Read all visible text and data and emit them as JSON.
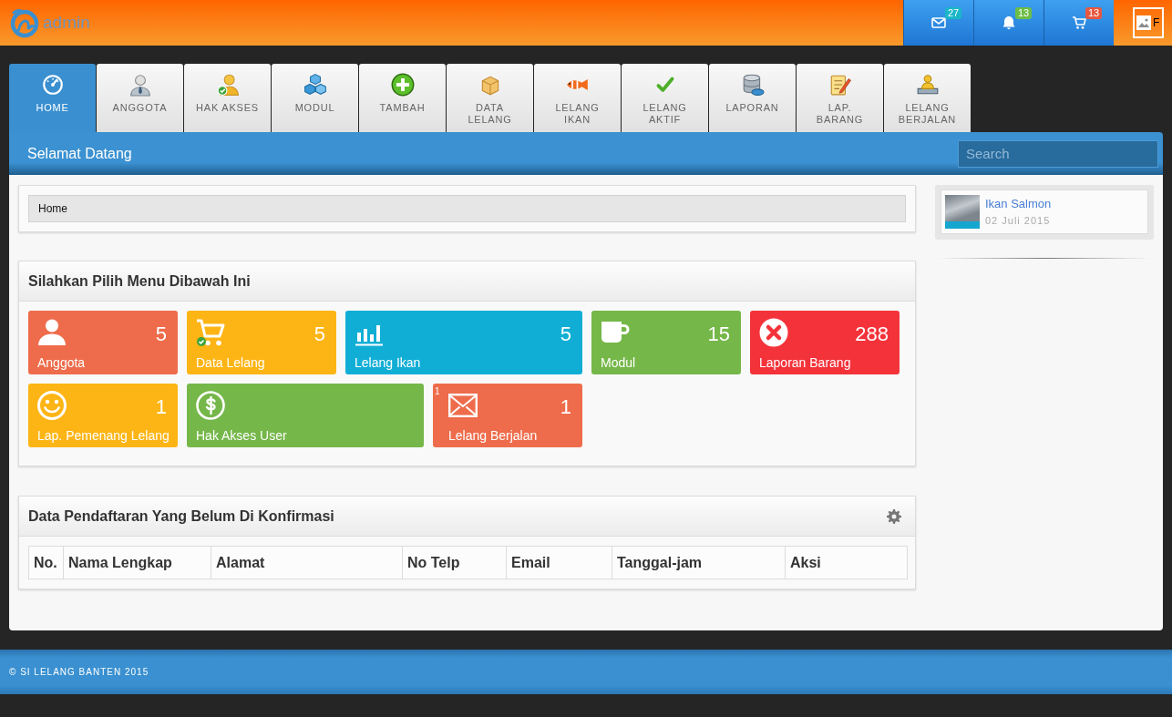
{
  "header": {
    "logo_text": "admin",
    "notifications": [
      {
        "count": "27",
        "color": "#1ab6c8"
      },
      {
        "count": "13",
        "color": "#6cbd45"
      },
      {
        "count": "13",
        "color": "#e8573f"
      }
    ],
    "user": {
      "label": "F"
    }
  },
  "tabs": [
    {
      "label": "HOME",
      "selected": true
    },
    {
      "label": "ANGGOTA",
      "selected": false
    },
    {
      "label": "HAK AKSES",
      "selected": false
    },
    {
      "label": "MODUL",
      "selected": false
    },
    {
      "label": "TAMBAH",
      "selected": false
    },
    {
      "label": "DATA LELANG",
      "selected": false
    },
    {
      "label": "LELANG IKAN",
      "selected": false
    },
    {
      "label": "LELANG AKTIF",
      "selected": false
    },
    {
      "label": "LAPORAN",
      "selected": false
    },
    {
      "label": "LAP. BARANG",
      "selected": false
    },
    {
      "label": "LELANG BERJALAN",
      "selected": false
    }
  ],
  "title_bar": {
    "title": "Selamat Datang",
    "search": {
      "placeholder": "Search"
    }
  },
  "breadcrumb": [
    "Home"
  ],
  "menu_panel": {
    "title": "Silahkan Pilih Menu Dibawah Ini",
    "rows": [
      [
        {
          "label": "Anggota",
          "count": "5",
          "color": "#ee6c4b",
          "wide": false
        },
        {
          "label": "Data Lelang",
          "count": "5",
          "color": "#fdb515",
          "wide": false
        },
        {
          "label": "Lelang Ikan",
          "count": "5",
          "color": "#10aed5",
          "wide": true
        },
        {
          "label": "Modul",
          "count": "15",
          "color": "#75b749",
          "wide": false
        },
        {
          "label": "Laporan Barang",
          "count": "288",
          "color": "#f4323a",
          "wide": false
        }
      ],
      [
        {
          "label": "Lap. Pemenang Lelang",
          "count": "1",
          "color": "#fdb515",
          "wide": false
        },
        {
          "label": "Hak Akses User",
          "color": "#75b749",
          "wide": true
        },
        {
          "label": "Lelang Berjalan",
          "count": "1",
          "color": "#ee6c4b",
          "wide": false,
          "note": "1"
        }
      ]
    ]
  },
  "registrations_panel": {
    "title": "Data Pendaftaran Yang Belum Di Konfirmasi",
    "table": {
      "columns": [
        "No.",
        "Nama Lengkap",
        "Alamat",
        "No Telp",
        "Email",
        "Tanggal-jam",
        "Aksi"
      ]
    }
  },
  "sidebar": {
    "posts": [
      {
        "title": "Ikan Salmon",
        "date": "02 Juli 2015"
      }
    ]
  },
  "footer": {
    "text": "© SI LELANG BANTEN 2015"
  }
}
